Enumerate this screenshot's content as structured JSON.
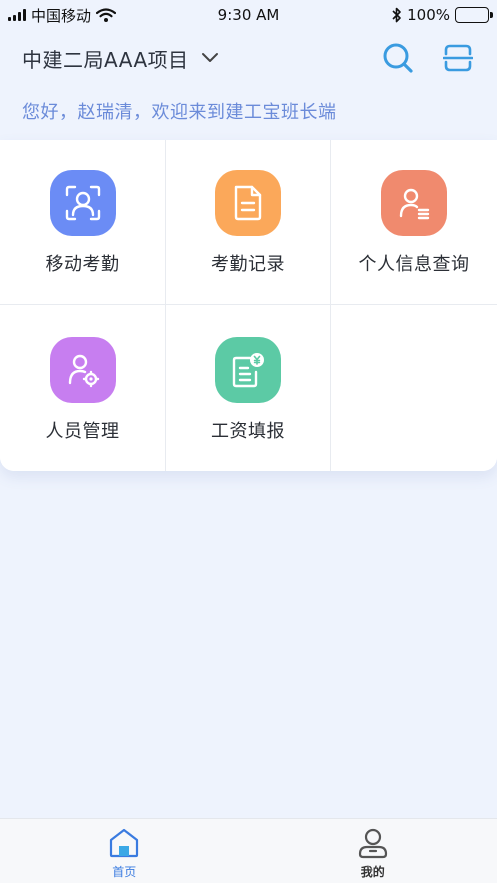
{
  "status_bar": {
    "carrier": "中国移动",
    "time": "9:30 AM",
    "battery": "100%"
  },
  "header": {
    "project_title": "中建二局AAA项目",
    "icons": [
      "chevron-down-icon",
      "search-icon",
      "scan-icon"
    ]
  },
  "greeting": "您好，赵瑞清，欢迎来到建工宝班长端",
  "colors": {
    "accent": "#3a9be0",
    "greeting": "#6b8bd9",
    "tile_attendance": "#6b8cf5",
    "tile_records": "#fba85a",
    "tile_personal": "#f08a6e",
    "tile_staff": "#c77ef0",
    "tile_salary": "#5ccaa5",
    "nav_active": "#3a7be0"
  },
  "menu": {
    "items": [
      {
        "label": "移动考勤",
        "icon": "face-scan-icon"
      },
      {
        "label": "考勤记录",
        "icon": "document-icon"
      },
      {
        "label": "个人信息查询",
        "icon": "person-list-icon"
      },
      {
        "label": "人员管理",
        "icon": "person-gear-icon"
      },
      {
        "label": "工资填报",
        "icon": "salary-form-icon"
      }
    ]
  },
  "bottom_nav": {
    "items": [
      {
        "label": "首页",
        "icon": "home-icon",
        "active": true
      },
      {
        "label": "我的",
        "icon": "profile-icon",
        "active": false
      }
    ]
  }
}
